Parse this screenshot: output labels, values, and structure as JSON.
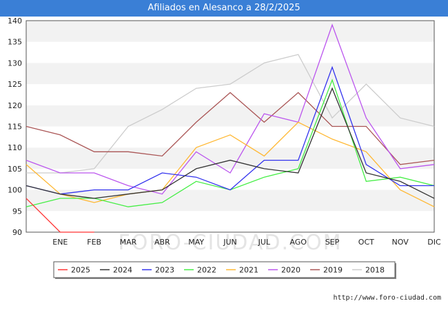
{
  "header": {
    "title": "Afiliados en Alesanco a 28/2/2025"
  },
  "footer": {
    "source": "http://www.foro-ciudad.com"
  },
  "watermark": "FORO-CIUDAD.COM",
  "chart_data": {
    "type": "line",
    "title": "Afiliados en Alesanco a 28/2/2025",
    "xlabel": "",
    "ylabel": "",
    "categories": [
      "",
      "ENE",
      "FEB",
      "MAR",
      "ABR",
      "MAY",
      "JUN",
      "JUL",
      "AGO",
      "SEP",
      "OCT",
      "NOV",
      "DIC"
    ],
    "ylim": [
      90,
      140
    ],
    "yticks": [
      90,
      95,
      100,
      105,
      110,
      115,
      120,
      125,
      130,
      135,
      140
    ],
    "grid": "horizontal bands",
    "legend_position": "bottom",
    "series": [
      {
        "name": "2025",
        "color": "#ff3333",
        "values": [
          98,
          90,
          90,
          null,
          null,
          null,
          null,
          null,
          null,
          null,
          null,
          null,
          null
        ]
      },
      {
        "name": "2024",
        "color": "#333333",
        "values": [
          101,
          99,
          98,
          99,
          100,
          105,
          107,
          105,
          104,
          124,
          104,
          102,
          98
        ]
      },
      {
        "name": "2023",
        "color": "#3333ee",
        "values": [
          101,
          99,
          100,
          100,
          104,
          103,
          100,
          107,
          107,
          129,
          106,
          101,
          101
        ]
      },
      {
        "name": "2022",
        "color": "#44ee44",
        "values": [
          96,
          98,
          98,
          96,
          97,
          102,
          100,
          103,
          105,
          126,
          102,
          103,
          101
        ]
      },
      {
        "name": "2021",
        "color": "#ffb833",
        "values": [
          106,
          99,
          97,
          99,
          100,
          110,
          113,
          108,
          116,
          112,
          109,
          100,
          96
        ]
      },
      {
        "name": "2020",
        "color": "#bb55ee",
        "values": [
          107,
          104,
          104,
          101,
          99,
          109,
          104,
          118,
          116,
          139,
          117,
          105,
          106
        ]
      },
      {
        "name": "2019",
        "color": "#aa5555",
        "values": [
          115,
          113,
          109,
          109,
          108,
          116,
          123,
          116,
          123,
          115,
          115,
          106,
          107
        ]
      },
      {
        "name": "2018",
        "color": "#cccccc",
        "values": [
          104,
          104,
          105,
          115,
          119,
          124,
          125,
          130,
          132,
          117,
          125,
          117,
          115
        ]
      }
    ]
  }
}
